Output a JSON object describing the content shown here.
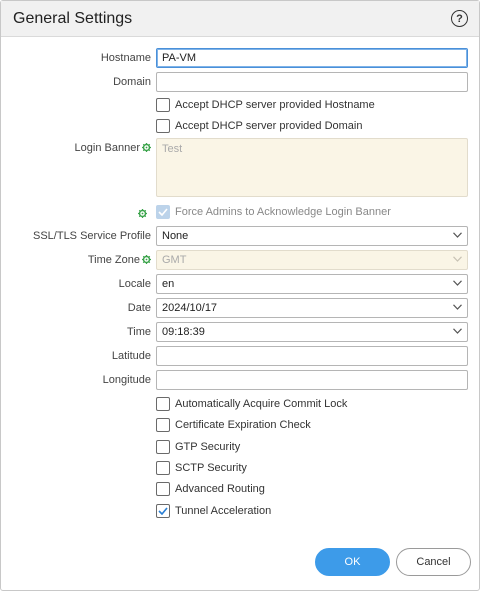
{
  "dialog": {
    "title": "General Settings"
  },
  "fields": {
    "hostname": {
      "label": "Hostname",
      "value": "PA-VM"
    },
    "domain": {
      "label": "Domain",
      "value": ""
    },
    "dhcp_hostname": {
      "label": "Accept DHCP server provided Hostname",
      "checked": false
    },
    "dhcp_domain": {
      "label": "Accept DHCP server provided Domain",
      "checked": false
    },
    "login_banner": {
      "label": "Login Banner",
      "placeholder": "Test"
    },
    "force_ack": {
      "label": "Force Admins to Acknowledge Login Banner",
      "checked": true,
      "disabled": true
    },
    "ssl_profile": {
      "label": "SSL/TLS Service Profile",
      "value": "None"
    },
    "time_zone": {
      "label": "Time Zone",
      "value": "GMT"
    },
    "locale": {
      "label": "Locale",
      "value": "en"
    },
    "date": {
      "label": "Date",
      "value": "2024/10/17"
    },
    "time": {
      "label": "Time",
      "value": "09:18:39"
    },
    "latitude": {
      "label": "Latitude",
      "value": ""
    },
    "longitude": {
      "label": "Longitude",
      "value": ""
    }
  },
  "options": [
    {
      "label": "Automatically Acquire Commit Lock",
      "checked": false
    },
    {
      "label": "Certificate Expiration Check",
      "checked": false
    },
    {
      "label": "GTP Security",
      "checked": false
    },
    {
      "label": "SCTP Security",
      "checked": false
    },
    {
      "label": "Advanced Routing",
      "checked": false
    },
    {
      "label": "Tunnel Acceleration",
      "checked": true
    }
  ],
  "buttons": {
    "ok": "OK",
    "cancel": "Cancel"
  },
  "colors": {
    "accent": "#3d9be9",
    "gear": "#3aa34a",
    "disabled_bg": "#faf5e6"
  },
  "icons": {
    "help": "question-circle-icon",
    "template": "gear-icon",
    "dropdown": "chevron-down-icon"
  }
}
